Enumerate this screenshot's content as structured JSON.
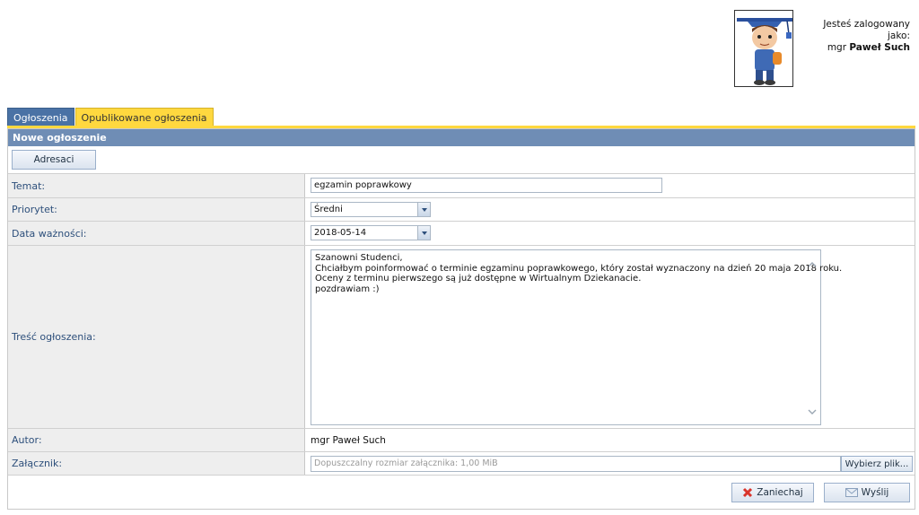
{
  "user": {
    "logged_in_label": "Jesteś zalogowany jako:",
    "title": "mgr",
    "name": "Paweł Such"
  },
  "tabs": [
    {
      "label": "Ogłoszenia",
      "active": true
    },
    {
      "label": "Opublikowane ogłoszenia",
      "active": false
    }
  ],
  "panel": {
    "title": "Nowe ogłoszenie",
    "recipients_button": "Adresaci"
  },
  "form": {
    "subject_label": "Temat:",
    "subject_value": "egzamin poprawkowy",
    "priority_label": "Priorytet:",
    "priority_value": "Średni",
    "expiry_label": "Data ważności:",
    "expiry_value": "2018-05-14",
    "content_label": "Treść ogłoszenia:",
    "content_lines": [
      "Szanowni Studenci,",
      "Chciałbym poinformować o terminie egzaminu poprawkowego, który został wyznaczony na dzień 20 maja 2018 roku.",
      "Oceny z terminu pierwszego są już dostępne w Wirtualnym Dziekanacie.",
      "pozdrawiam :)"
    ],
    "author_label": "Autor:",
    "author_value": "mgr Paweł Such",
    "attachment_label": "Załącznik:",
    "attachment_placeholder": "Dopuszczalny rozmiar załącznika: 1,00 MiB",
    "choose_file_button": "Wybierz plik..."
  },
  "actions": {
    "cancel": "Zaniechaj",
    "send": "Wyślij"
  },
  "colors": {
    "tab_active": "#4a72a5",
    "tab_yellow": "#ffd83f",
    "panel_header": "#6f8db5",
    "label_text": "#2d4f7b"
  }
}
